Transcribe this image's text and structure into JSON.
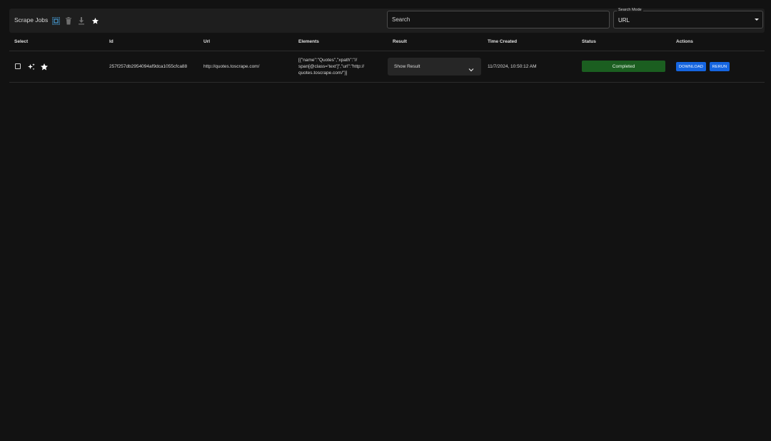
{
  "toolbar": {
    "title": "Scrape Jobs",
    "icons": [
      "select-all-icon",
      "trash-icon",
      "download-icon",
      "star-icon"
    ],
    "search_placeholder": "Search",
    "search_mode_label": "Search Mode",
    "search_mode_value": "URL"
  },
  "table": {
    "headers": [
      "Select",
      "Id",
      "Url",
      "Elements",
      "Result",
      "Time Created",
      "Status",
      "Actions"
    ],
    "rows": [
      {
        "id": "257f257db2954094af9dca1055cfca88",
        "url": "http://quotes.toscrape.com/",
        "elements_line1": "[{\"name\":\"Quotes\",\"xpath\":\"//",
        "elements_line2": "span[@class='text']\",\"url\":\"http://",
        "elements_line3": "quotes.toscrape.com/\"}]",
        "result_label": "Show Result",
        "time_created": "11/7/2024, 10:50:12 AM",
        "status": "Completed",
        "download_label": "DOWNLOAD",
        "rerun_label": "RERUN",
        "row_icons": [
          "sparkle-icon",
          "star-icon"
        ]
      }
    ]
  },
  "colors": {
    "background": "#121212",
    "toolbar": "#1e1e1e",
    "status_completed": "#1b5e20",
    "action_button": "#1565e0"
  }
}
